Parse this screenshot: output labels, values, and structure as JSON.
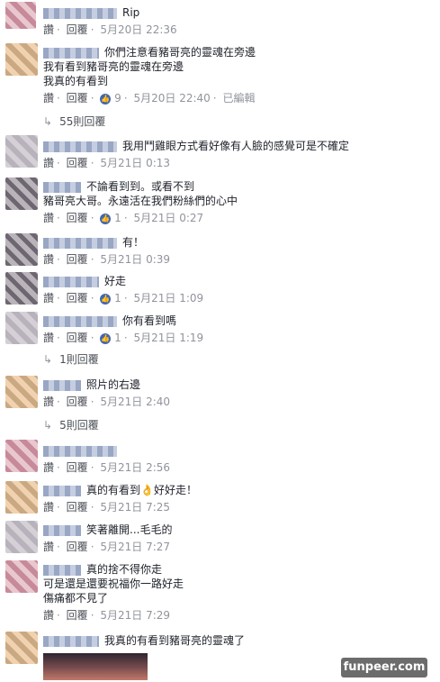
{
  "labels": {
    "like": "讚",
    "reply": "回覆",
    "dot": "·"
  },
  "top": {
    "text": "Rip",
    "time": "5月20日 22:36"
  },
  "comments": [
    {
      "lines": [
        "你們注意看豬哥亮的靈魂在旁邊",
        "我有看到豬哥亮的靈魂在旁邊",
        "我真的有看到"
      ],
      "likes": "9",
      "time": "5月20日 22:40",
      "edited": "已編輯",
      "replies": "55則回覆"
    },
    {
      "lines": [
        "我用鬥雞眼方式看好像有人臉的感覺可是不確定"
      ],
      "time": "5月21日 0:13"
    },
    {
      "lines": [
        "不論看到到。或看不到",
        "豬哥亮大哥。永遠活在我們粉絲們的心中"
      ],
      "likes": "1",
      "time": "5月21日 0:27"
    },
    {
      "lines": [
        "有！"
      ],
      "time": "5月21日 0:39"
    },
    {
      "lines": [
        "好走"
      ],
      "likes": "1",
      "time": "5月21日 1:09"
    },
    {
      "lines": [
        "你有看到嗎"
      ],
      "likes": "1",
      "time": "5月21日 1:19",
      "replies": "1則回覆"
    },
    {
      "lines": [
        "照片的右邊"
      ],
      "time": "5月21日 2:40",
      "replies": "5則回覆"
    },
    {
      "lines": [
        ""
      ],
      "time": "5月21日 2:56"
    },
    {
      "lines": [
        "真的有看到👌好好走！"
      ],
      "time": "5月21日 7:25"
    },
    {
      "lines": [
        "笑著離開...毛毛的"
      ],
      "time": "5月21日 7:27"
    },
    {
      "lines": [
        "真的捨不得你走",
        "可是還是還要祝福你一路好走",
        "傷痛都不見了"
      ],
      "time": "5月21日 7:29"
    },
    {
      "lines": [
        "我真的有看到豬哥亮的靈魂了"
      ]
    }
  ],
  "watermark": "funpeer.com"
}
